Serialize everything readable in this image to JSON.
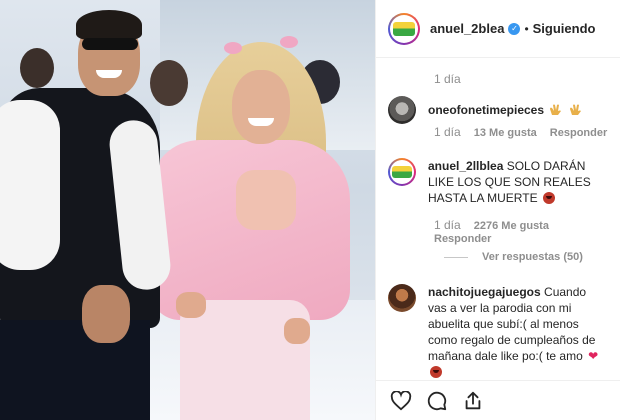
{
  "post": {
    "username": "anuel_2blea",
    "follow_status": "Siguiendo",
    "separator": "•",
    "verified_mark": "✓",
    "caption_time": "1 día"
  },
  "comments": [
    {
      "username": "oneofonetimepieces",
      "text": "",
      "time": "1 día",
      "likes": "13 Me gusta",
      "reply": "Responder"
    },
    {
      "username": "anuel_2llblea",
      "text": " SOLO DARÁN LIKE LOS QUE SON REALES HASTA LA MUERTE",
      "time": "1 día",
      "likes": "2276 Me gusta",
      "reply": "Responder",
      "view_replies": "Ver respuestas (50)"
    },
    {
      "username": "nachitojuegajuegos",
      "text": " Cuando vas a ver la parodia con mi abuelita que subí:( al menos como regalo de cumpleaños de mañana dale like po:( te amo"
    }
  ],
  "icons": {
    "like": "heart-icon",
    "comment": "comment-icon",
    "share": "share-icon"
  },
  "colors": {
    "verified": "#3897f0",
    "muted_text": "#8e8e8e",
    "primary_text": "#262626"
  }
}
